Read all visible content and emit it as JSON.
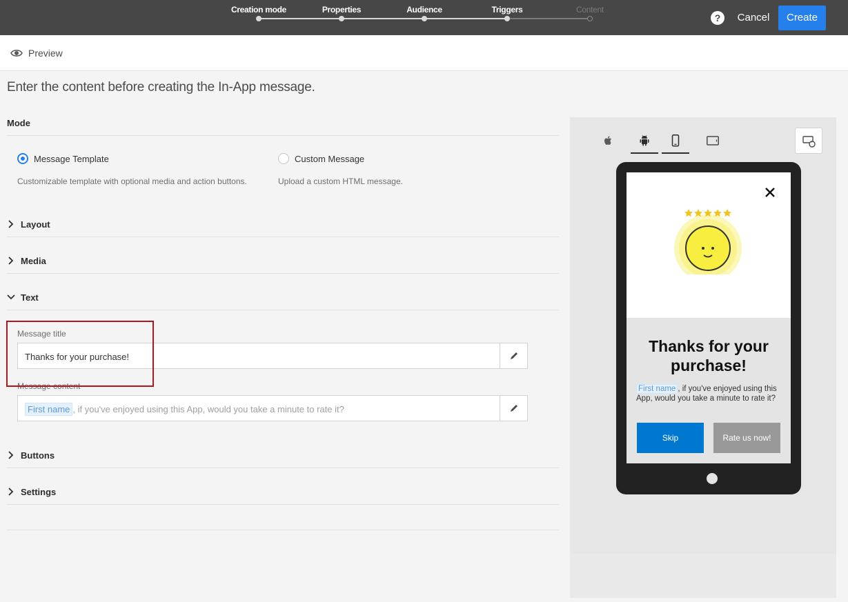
{
  "header": {
    "steps": [
      {
        "label": "Creation mode",
        "active": true
      },
      {
        "label": "Properties",
        "active": true
      },
      {
        "label": "Audience",
        "active": true
      },
      {
        "label": "Triggers",
        "active": true
      },
      {
        "label": "Content",
        "active": false
      }
    ],
    "help_label": "?",
    "cancel_label": "Cancel",
    "create_label": "Create",
    "accent_color": "#2680eb"
  },
  "preview_bar": {
    "label": "Preview",
    "icon": "eye-icon"
  },
  "intro": "Enter the content before creating the In-App message.",
  "mode": {
    "title": "Mode",
    "options": [
      {
        "label": "Message Template",
        "desc": "Customizable template with optional media and action buttons.",
        "selected": true
      },
      {
        "label": "Custom Message",
        "desc": "Upload a custom HTML message.",
        "selected": false
      }
    ]
  },
  "sections": {
    "layout": "Layout",
    "media": "Media",
    "text": "Text",
    "buttons": "Buttons",
    "settings": "Settings"
  },
  "text_section": {
    "title_label": "Message title",
    "title_value": "Thanks for your purchase!",
    "content_label": "Message content",
    "content_token": "First name",
    "content_placeholder": ", if you've enjoyed using this App, would you take a minute to rate it?"
  },
  "device_preview": {
    "platforms": [
      {
        "icon": "apple-icon",
        "active": false
      },
      {
        "icon": "android-icon",
        "active": true
      },
      {
        "icon": "phone-icon",
        "active": true
      },
      {
        "icon": "tablet-icon",
        "active": false
      }
    ],
    "message": {
      "title": "Thanks for your purchase!",
      "body_token": "First name",
      "body_text": ", if you've enjoyed using this App, would you take a minute to rate it?",
      "skip_label": "Skip",
      "rate_label": "Rate us now!",
      "skip_color": "#0077d0",
      "rate_color": "#999999"
    }
  }
}
